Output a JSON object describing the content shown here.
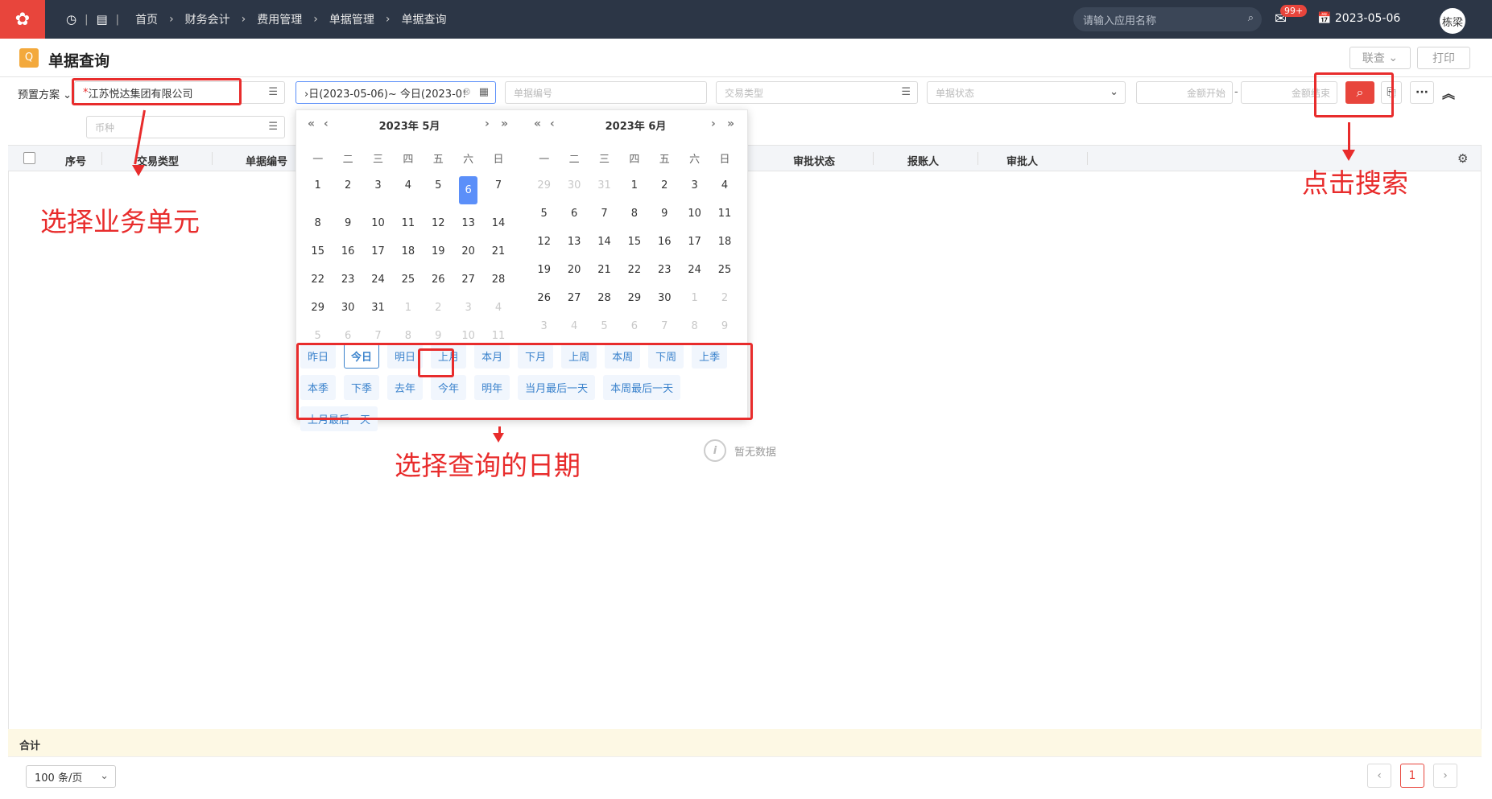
{
  "topbar": {
    "breadcrumbs": [
      "首页",
      "财务会计",
      "费用管理",
      "单据管理",
      "单据查询"
    ],
    "search_placeholder": "请输入应用名称",
    "msg_badge": "99+",
    "date": "2023-05-06",
    "user": "栋梁"
  },
  "page": {
    "title": "单据查询",
    "link_query_btn": "联查",
    "print_btn": "打印"
  },
  "filters": {
    "preset_label": "预置方案",
    "business_unit_value": "江苏悦达集团有限公司",
    "date_range_value": "›日(2023-05-06)~ 今日(2023-0!",
    "doc_no_placeholder": "单据编号",
    "trans_type_placeholder": "交易类型",
    "doc_status_placeholder": "单据状态",
    "amount_start_placeholder": "金额开始",
    "amount_end_placeholder": "金额结束",
    "amount_sep": "-",
    "currency_placeholder": "币种"
  },
  "grid": {
    "columns": [
      "序号",
      "交易类型",
      "单据编号",
      "审批状态",
      "报账人",
      "审批人"
    ],
    "empty_text": "暂无数据",
    "total_label": "合计"
  },
  "footer": {
    "page_size": "100 条/页",
    "current_page": "1",
    "prev": "‹",
    "next": "›"
  },
  "picker": {
    "left_title": "2023年 5月",
    "right_title": "2023年 6月",
    "weekdays": [
      "一",
      "二",
      "三",
      "四",
      "五",
      "六",
      "日"
    ],
    "may_days": [
      "1",
      "2",
      "3",
      "4",
      "5",
      "6",
      "7",
      "8",
      "9",
      "10",
      "11",
      "12",
      "13",
      "14",
      "15",
      "16",
      "17",
      "18",
      "19",
      "20",
      "21",
      "22",
      "23",
      "24",
      "25",
      "26",
      "27",
      "28",
      "29",
      "30",
      "31",
      "1",
      "2",
      "3",
      "4",
      "5",
      "6",
      "7",
      "8",
      "9",
      "10",
      "11"
    ],
    "june_days": [
      "29",
      "30",
      "31",
      "1",
      "2",
      "3",
      "4",
      "5",
      "6",
      "7",
      "8",
      "9",
      "10",
      "11",
      "12",
      "13",
      "14",
      "15",
      "16",
      "17",
      "18",
      "19",
      "20",
      "21",
      "22",
      "23",
      "24",
      "25",
      "26",
      "27",
      "28",
      "29",
      "30",
      "1",
      "2",
      "3",
      "4",
      "5",
      "6",
      "7",
      "8",
      "9"
    ],
    "quick": [
      "昨日",
      "今日",
      "明日",
      "上月",
      "本月",
      "下月",
      "上周",
      "本周",
      "下周",
      "上季",
      "本季",
      "下季",
      "去年",
      "今年",
      "明年",
      "当月最后一天",
      "本周最后一天",
      "上月最后一天"
    ]
  },
  "annotations": {
    "select_unit": "选择业务单元",
    "select_date": "选择查询的日期",
    "click_search": "点击搜索"
  }
}
